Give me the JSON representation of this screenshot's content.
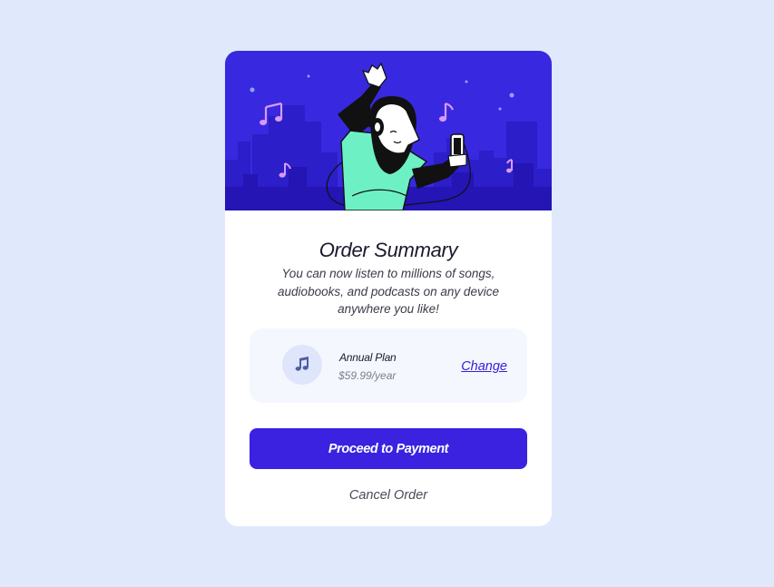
{
  "order": {
    "title": "Order Summary",
    "description": "You can now listen to millions of songs, audiobooks, and podcasts on any device anywhere you like!"
  },
  "plan": {
    "name": "Annual Plan",
    "price": "$59.99/year",
    "change_label": "Change",
    "icon": "music-note-icon"
  },
  "actions": {
    "proceed_label": "Proceed to Payment",
    "cancel_label": "Cancel Order"
  },
  "colors": {
    "page_background": "#e0e8fc",
    "hero_background": "#3829e0",
    "accent": "#3a22e0",
    "plan_background": "#f5f7ff"
  }
}
